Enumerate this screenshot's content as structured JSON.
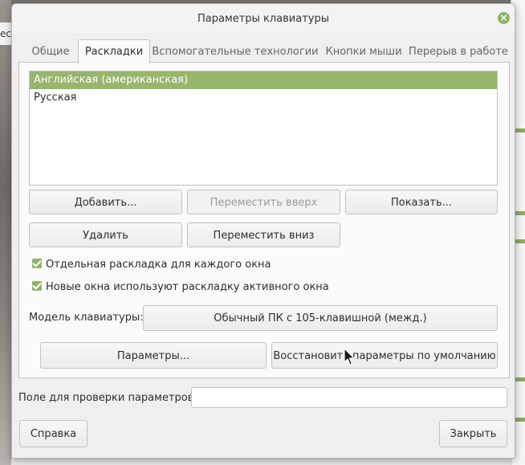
{
  "window": {
    "title": "Параметры клавиатуры"
  },
  "tabs": [
    {
      "label": "Общие",
      "active": false
    },
    {
      "label": "Раскладки",
      "active": true
    },
    {
      "label": "Вспомогательные технологии",
      "active": false
    },
    {
      "label": "Кнопки мыши",
      "active": false
    },
    {
      "label": "Перерыв в работе",
      "active": false
    }
  ],
  "layouts": {
    "items": [
      {
        "label": "Английская (американская)",
        "selected": true
      },
      {
        "label": "Русская",
        "selected": false
      }
    ]
  },
  "buttons": {
    "add": "Добавить...",
    "move_up": "Переместить вверх",
    "show": "Показать...",
    "remove": "Удалить",
    "move_down": "Переместить вниз",
    "options": "Параметры...",
    "reset": "Восстановить параметры по умолчанию",
    "help": "Справка",
    "close": "Закрыть"
  },
  "checkboxes": [
    {
      "label": "Отдельная раскладка для каждого окна",
      "checked": true
    },
    {
      "label": "Новые окна используют раскладку активного окна",
      "checked": true
    }
  ],
  "model": {
    "label": "Модель клавиатуры:",
    "value": "Обычный ПК с 105-клавишной (межд.)"
  },
  "test_field": {
    "label": "Поле для проверки параметров:",
    "value": ""
  },
  "background": {
    "left_fragment": "ec"
  },
  "colors": {
    "accent": "#8fb368",
    "selection": "#97b56d"
  }
}
